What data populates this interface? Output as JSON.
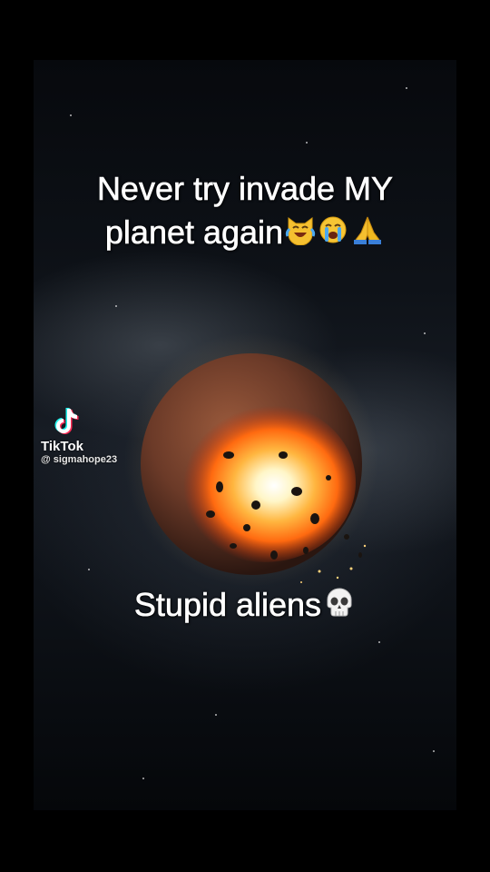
{
  "caption_top": {
    "line1": "Never try invade MY",
    "line2": "planet again"
  },
  "caption_bottom": "Stupid aliens",
  "emojis": {
    "caption_top": [
      "cat-tears-of-joy-icon",
      "loudly-crying-face-icon",
      "folded-hands-icon"
    ],
    "caption_bottom": [
      "skull-icon"
    ]
  },
  "watermark": {
    "brand": "TikTok",
    "handle": "@ sigmahope23",
    "icon": "tiktok-logo-icon"
  },
  "colors": {
    "background": "#000000",
    "text": "#ffffff",
    "explosion_core": "#fff6c8",
    "explosion_fire": "#ff7a1a",
    "planet_surface": "#6b3a28"
  }
}
